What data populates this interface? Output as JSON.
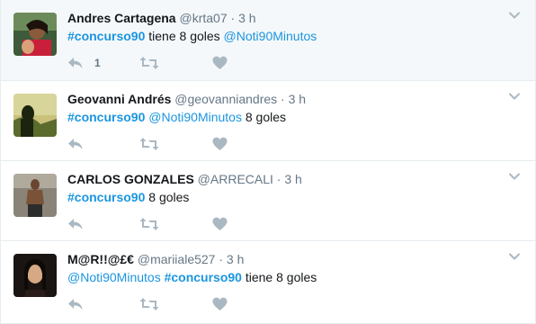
{
  "colors": {
    "link": "#1b95e0",
    "meta": "#657786",
    "icon": "#aab8c2",
    "highlight_bg": "#f5f8fa",
    "divider": "#e6ecf0"
  },
  "tweets": [
    {
      "fullname": "Andres Cartagena",
      "username": "@krta07",
      "sep": "·",
      "time": "3 h",
      "text": [
        {
          "t": "#concurso90",
          "kind": "hashtag"
        },
        {
          "t": " tiene 8 goles ",
          "kind": "text"
        },
        {
          "t": "@Noti90Minutos",
          "kind": "mention"
        }
      ],
      "reply_count": "1",
      "icons": {
        "reply": "reply-icon",
        "retweet": "retweet-icon",
        "like": "heart-icon",
        "menu": "chevron-down-icon"
      }
    },
    {
      "fullname": "Geovanni Andrés",
      "username": "@geovanniandres",
      "sep": "·",
      "time": "3 h",
      "text": [
        {
          "t": "#concurso90",
          "kind": "hashtag"
        },
        {
          "t": " ",
          "kind": "text"
        },
        {
          "t": "@Noti90Minutos",
          "kind": "mention"
        },
        {
          "t": " 8 goles",
          "kind": "text"
        }
      ],
      "reply_count": "",
      "icons": {
        "reply": "reply-icon",
        "retweet": "retweet-icon",
        "like": "heart-icon",
        "menu": "chevron-down-icon"
      }
    },
    {
      "fullname": "CARLOS GONZALES",
      "username": "@ARRECALI",
      "sep": "·",
      "time": "3 h",
      "text": [
        {
          "t": "#concurso90",
          "kind": "hashtag"
        },
        {
          "t": " 8 goles",
          "kind": "text"
        }
      ],
      "reply_count": "",
      "icons": {
        "reply": "reply-icon",
        "retweet": "retweet-icon",
        "like": "heart-icon",
        "menu": "chevron-down-icon"
      }
    },
    {
      "fullname": "M@R!!@£€",
      "username": "@mariiale527",
      "sep": "·",
      "time": "3 h",
      "text": [
        {
          "t": "@Noti90Minutos",
          "kind": "mention"
        },
        {
          "t": " ",
          "kind": "text"
        },
        {
          "t": "#concurso90",
          "kind": "hashtag"
        },
        {
          "t": " tiene 8 goles",
          "kind": "text"
        }
      ],
      "reply_count": "",
      "icons": {
        "reply": "reply-icon",
        "retweet": "retweet-icon",
        "like": "heart-icon",
        "menu": "chevron-down-icon"
      }
    }
  ]
}
